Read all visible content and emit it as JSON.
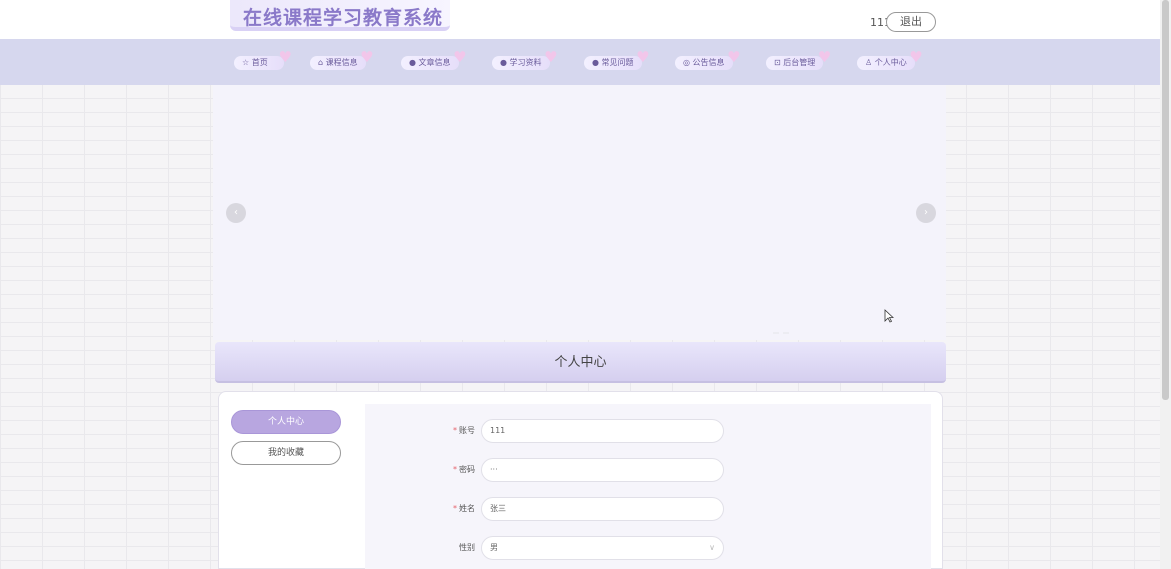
{
  "header": {
    "title": "在线课程学习教育系统",
    "username": "111",
    "logout_label": "退出"
  },
  "nav": {
    "items": [
      {
        "icon": "☆",
        "label": "首页"
      },
      {
        "icon": "⌂",
        "label": "课程信息"
      },
      {
        "icon": "●",
        "label": "文章信息"
      },
      {
        "icon": "●",
        "label": "学习资料"
      },
      {
        "icon": "●",
        "label": "常见问题"
      },
      {
        "icon": "◎",
        "label": "公告信息"
      },
      {
        "icon": "⊡",
        "label": "后台管理"
      },
      {
        "icon": "♙",
        "label": "个人中心"
      }
    ]
  },
  "banner": {
    "prev_icon": "‹",
    "next_icon": "›"
  },
  "section": {
    "title": "个人中心"
  },
  "sidebar": {
    "items": [
      {
        "label": "个人中心",
        "active": true
      },
      {
        "label": "我的收藏",
        "active": false
      }
    ]
  },
  "form": {
    "fields": [
      {
        "label": "账号",
        "required": true,
        "value": "111"
      },
      {
        "label": "密码",
        "required": true,
        "value": "···"
      },
      {
        "label": "姓名",
        "required": true,
        "value": "张三"
      },
      {
        "label": "性别",
        "required": false,
        "value": "男",
        "type": "select"
      }
    ]
  },
  "colors": {
    "accent": "#b8a6e0",
    "navbar": "#d6d7ee",
    "title_text": "#8a79c9"
  }
}
